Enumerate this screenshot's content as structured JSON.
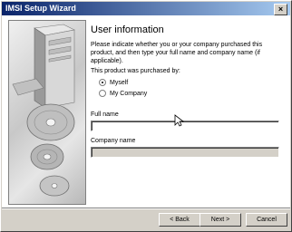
{
  "window": {
    "title": "IMSI Setup Wizard",
    "close_symbol": "×"
  },
  "page": {
    "heading": "User information",
    "description": "Please indicate whether you or your company purchased this product, and then type your full name and company name (if applicable).",
    "purchased_label": "This product was purchased by:"
  },
  "options": {
    "myself": {
      "label": "Myself",
      "selected": true
    },
    "company": {
      "label": "My Company",
      "selected": false
    }
  },
  "fields": {
    "full_name": {
      "label": "Full name",
      "value": ""
    },
    "company_name": {
      "label": "Company name",
      "value": "",
      "enabled": false
    }
  },
  "buttons": {
    "back": "< Back",
    "next": "Next >",
    "cancel": "Cancel"
  },
  "colors": {
    "titlebar_start": "#0a246a",
    "titlebar_end": "#a6caf0",
    "face": "#d4d0c8"
  }
}
